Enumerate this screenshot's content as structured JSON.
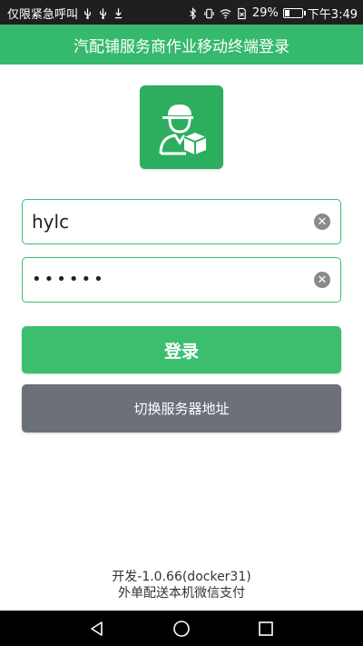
{
  "status_bar": {
    "left_text": "仅限紧急呼叫",
    "battery_text": "29%",
    "battery_level": 0.29,
    "time": "下午3:49"
  },
  "header": {
    "title": "汽配铺服务商作业移动终端登录"
  },
  "logo": {
    "icon": "delivery-person-icon",
    "color": "#2cae5e"
  },
  "login_form": {
    "username_value": "hylc",
    "password_value": "••••••",
    "clear_icon": "clear-icon"
  },
  "buttons": {
    "login_label": "登录",
    "switch_server_label": "切换服务器地址"
  },
  "footer": {
    "version": "开发-1.0.66(docker31)",
    "note": "外单配送本机微信支付"
  },
  "colors": {
    "accent": "#35b96d",
    "secondary_button": "#6c7179"
  }
}
